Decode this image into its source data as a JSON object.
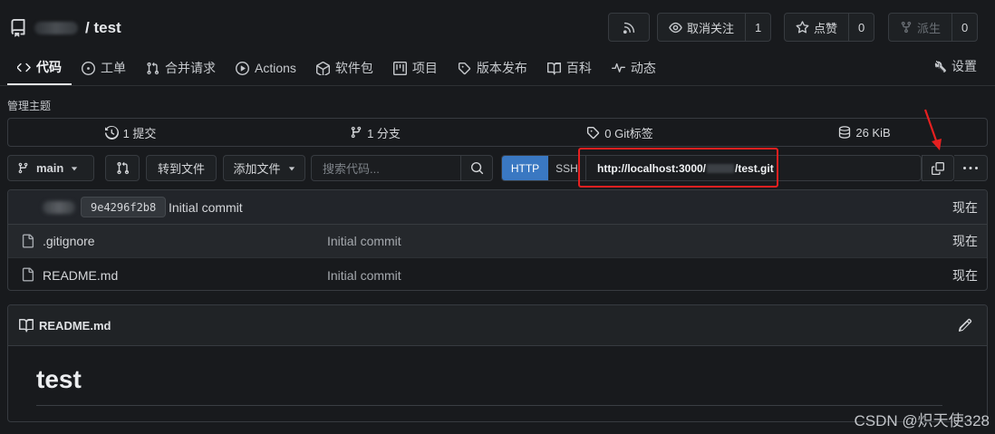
{
  "repo": {
    "separator": "/",
    "name": "test"
  },
  "header_buttons": {
    "watch_label": "取消关注",
    "watch_count": "1",
    "star_label": "点赞",
    "star_count": "0",
    "fork_label": "派生",
    "fork_count": "0"
  },
  "tabs": [
    {
      "label": "代码"
    },
    {
      "label": "工单"
    },
    {
      "label": "合并请求"
    },
    {
      "label": "Actions"
    },
    {
      "label": "软件包"
    },
    {
      "label": "项目"
    },
    {
      "label": "版本发布"
    },
    {
      "label": "百科"
    },
    {
      "label": "动态"
    }
  ],
  "settings_label": "设置",
  "topics_label": "管理主题",
  "stats": {
    "commits": "1 提交",
    "branches": "1 分支",
    "tags": "0 Git标签",
    "size": "26 KiB"
  },
  "toolbar": {
    "branch": "main",
    "goto_file": "转到文件",
    "add_file": "添加文件",
    "search_placeholder": "搜索代码...",
    "http": "HTTP",
    "ssh": "SSH",
    "url_prefix": "http://localhost:3000/",
    "url_suffix": "/test.git"
  },
  "latest_commit": {
    "sha": "9e4296f2b8",
    "message": "Initial commit",
    "time": "现在"
  },
  "files": [
    {
      "name": ".gitignore",
      "message": "Initial commit",
      "time": "现在"
    },
    {
      "name": "README.md",
      "message": "Initial commit",
      "time": "现在"
    }
  ],
  "readme": {
    "filename": "README.md",
    "heading": "test"
  },
  "watermark": "CSDN @炽天使328",
  "colors": {
    "accent": "#3a78c2",
    "highlight": "#e62020",
    "background": "#181a1d"
  }
}
